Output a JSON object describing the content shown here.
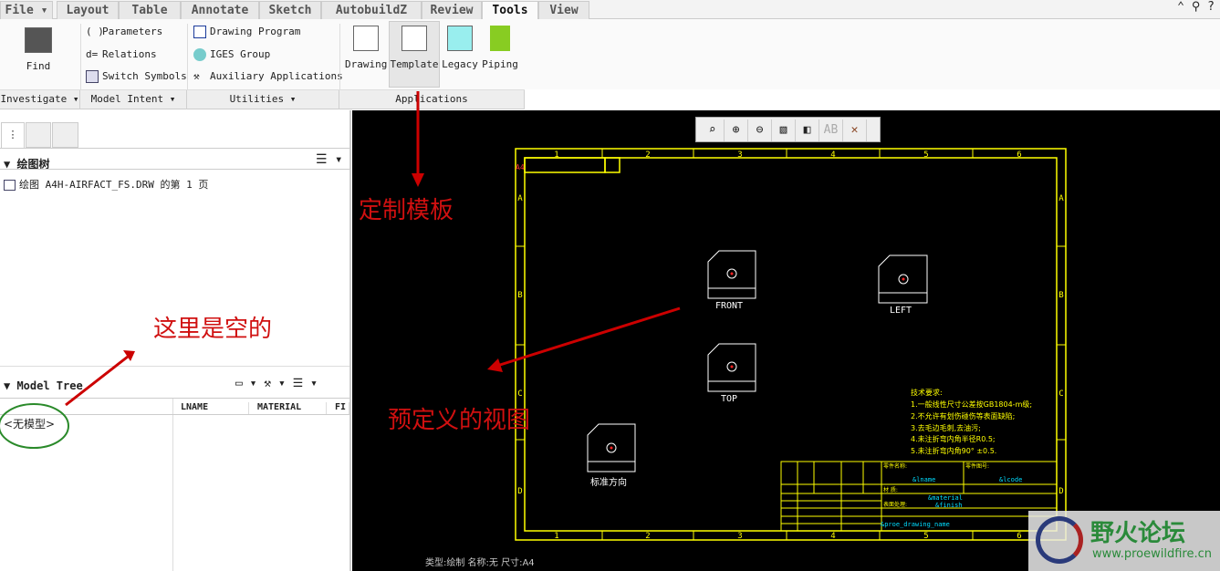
{
  "menu": {
    "file": "File",
    "tabs": [
      "Layout",
      "Table",
      "Annotate",
      "Sketch",
      "AutobuildZ",
      "Review",
      "Tools",
      "View"
    ],
    "active": "Tools"
  },
  "ribbon": {
    "find": "Find",
    "model_intent": [
      "Parameters",
      "Relations",
      "Switch Symbols"
    ],
    "utilities": [
      "Drawing Program",
      "IGES Group",
      "Auxiliary Applications"
    ],
    "applications": [
      "Drawing",
      "Template",
      "Legacy",
      "Piping"
    ],
    "groups": [
      "Investigate",
      "Model Intent",
      "Utilities",
      "Applications"
    ]
  },
  "left": {
    "drawing_tree_title": "绘图树",
    "drawing_tree_item": "绘图 A4H-AIRFACT_FS.DRW 的第 1 页",
    "model_tree_title": "Model Tree",
    "columns": [
      "LNAME",
      "MATERIAL",
      "FI"
    ],
    "no_model": "<无模型>"
  },
  "drawing": {
    "views": [
      "FRONT",
      "LEFT",
      "TOP",
      "标准方向"
    ],
    "col_labels": [
      "1",
      "2",
      "3",
      "4",
      "5",
      "6"
    ],
    "row_labels": [
      "A",
      "B",
      "C",
      "D"
    ],
    "sheet_size": "A4",
    "notes": [
      "技术要求:",
      "1.一般线性尺寸公差按GB1804-m级;",
      "2.不允许有划伤碰伤等表面缺陷;",
      "3.去毛边毛刺,去油污;",
      "4.未注折弯内角半径R0.5;",
      "5.未注折弯内角90° ±0.5."
    ],
    "title_block": {
      "name_param": "&lname",
      "code_param": "&lcode",
      "material_param": "&material",
      "finish_param": "&finish",
      "name_label": "零件名称:",
      "code_label": "零件图号:",
      "material_label": "材  质:",
      "finish_label": "表面处理:",
      "drawing_footer": "&proe_drawing_name"
    },
    "status": "类型:绘制  名称:无  尺寸:A4"
  },
  "annotations": {
    "template": "定制模板",
    "empty": "这里是空的",
    "views": "预定义的视图"
  },
  "watermark": {
    "name": "野火论坛",
    "url": "www.proewildfire.cn"
  },
  "colors": {
    "annotation": "#d01010",
    "frame": "#ffff00",
    "param": "#00e0ff",
    "circle": "#2a8a2a"
  }
}
